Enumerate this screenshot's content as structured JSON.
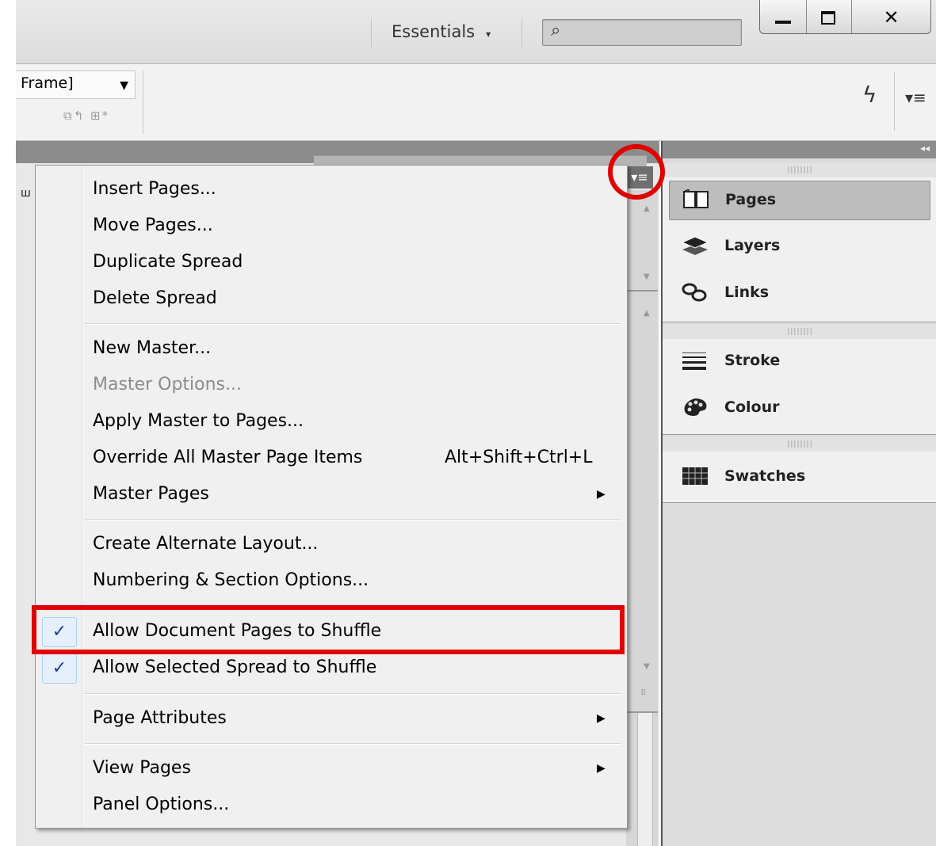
{
  "topbar": {
    "workspace_label": "Essentials",
    "workspace_arrow": "▾",
    "search_icon": "⌕",
    "window_buttons": {
      "close_glyph": "✕"
    }
  },
  "controlbar": {
    "frame_select_value": "Frame]",
    "frame_select_arrow": "▼",
    "frame_tools_glyphs": "⧉↰ ⊞*",
    "lightning_glyph": "ϟ",
    "menu_glyph": "▾≡"
  },
  "document": {
    "ruler_glyph": "ш",
    "panel_menu_glyph": "▾≡"
  },
  "scroll_glyphs": {
    "up": "▲",
    "down": "▼",
    "grip": "⠿"
  },
  "menu": {
    "items": [
      {
        "label": "Insert Pages..."
      },
      {
        "label": "Move Pages..."
      },
      {
        "label": "Duplicate Spread"
      },
      {
        "label": "Delete Spread"
      },
      {
        "label": "New Master..."
      },
      {
        "label": "Master Options...",
        "disabled": true
      },
      {
        "label": "Apply Master to Pages..."
      },
      {
        "label": "Override All Master Page Items",
        "shortcut": "Alt+Shift+Ctrl+L"
      },
      {
        "label": "Master Pages",
        "submenu": true
      },
      {
        "label": "Create Alternate Layout..."
      },
      {
        "label": "Numbering & Section Options..."
      },
      {
        "label": "Allow Document Pages to Shuffle",
        "checked": true
      },
      {
        "label": "Allow Selected Spread to Shuffle",
        "checked": true
      },
      {
        "label": "Page Attributes",
        "submenu": true
      },
      {
        "label": "View Pages",
        "submenu": true
      },
      {
        "label": "Panel Options..."
      }
    ],
    "submenu_arrow": "▶",
    "check_glyph": "✓"
  },
  "dock": {
    "collapse_glyph": "◂◂",
    "grip_glyph": "||||||||",
    "groups": [
      {
        "items": [
          {
            "name": "Pages",
            "icon": "pages-icon",
            "active": true
          },
          {
            "name": "Layers",
            "icon": "layers-icon"
          },
          {
            "name": "Links",
            "icon": "links-icon"
          }
        ]
      },
      {
        "items": [
          {
            "name": "Stroke",
            "icon": "stroke-icon"
          },
          {
            "name": "Colour",
            "icon": "colour-icon"
          }
        ]
      },
      {
        "items": [
          {
            "name": "Swatches",
            "icon": "swatches-icon"
          }
        ]
      }
    ]
  },
  "colors": {
    "annotation_red": "#e00000",
    "check_blue": "#1a3fa8",
    "disabled_text": "#8c8c8c"
  }
}
